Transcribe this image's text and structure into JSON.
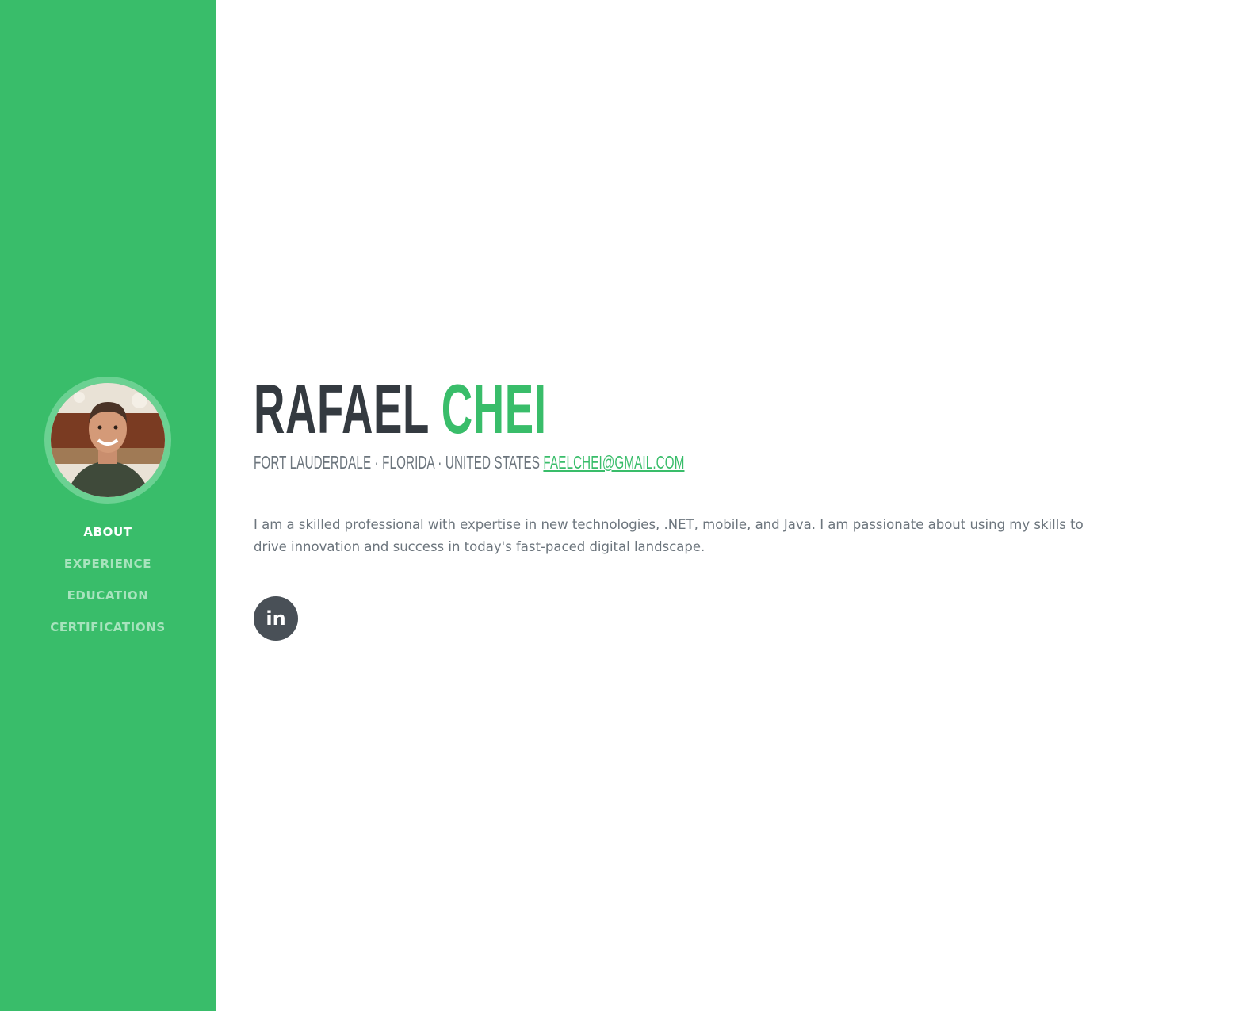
{
  "colors": {
    "primary": "#39bd6a",
    "avatar_ring": "#6bd192",
    "nav_inactive": "#a7e3bd",
    "heading_dark": "#343a40",
    "body_text": "#6c757d",
    "social_bg": "#495057"
  },
  "sidebar": {
    "nav": [
      {
        "label": "ABOUT",
        "active": true
      },
      {
        "label": "EXPERIENCE",
        "active": false
      },
      {
        "label": "EDUCATION",
        "active": false
      },
      {
        "label": "CERTIFICATIONS",
        "active": false
      }
    ]
  },
  "about": {
    "first_name": "RAFAEL",
    "last_name": "CHEI",
    "location": "FORT LAUDERDALE · FLORIDA · UNITED STATES",
    "email": "FAELCHEI@GMAIL.COM",
    "bio": "I am a skilled professional with expertise in new technologies, .NET, mobile, and Java. I am passionate about using my skills to drive innovation and success in today's fast-paced digital landscape.",
    "social": [
      {
        "icon": "linkedin-icon",
        "glyph": "in"
      }
    ]
  }
}
